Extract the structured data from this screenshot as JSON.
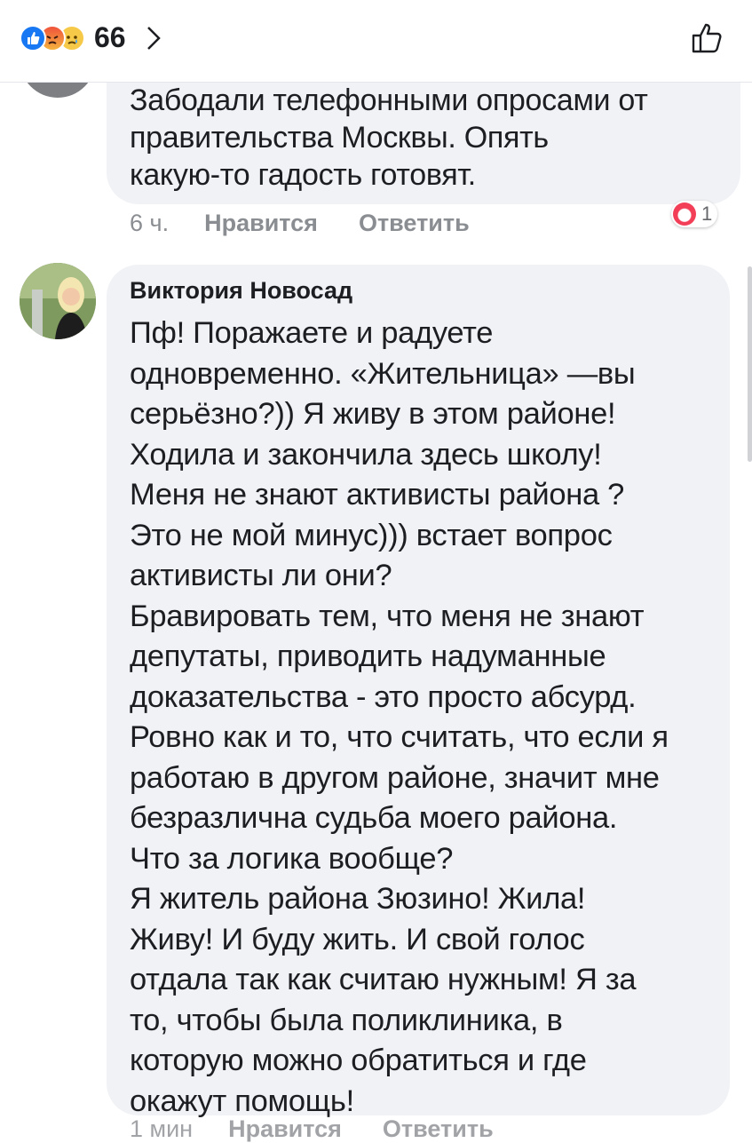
{
  "header": {
    "reaction_count": "66",
    "reaction_icons": [
      "like-icon",
      "angry-icon",
      "sad-icon"
    ],
    "like_icon": "thumbs-up-outline-icon"
  },
  "previous_comment": {
    "text": "Забодали телефонными опросами от\nправительства Москвы. Опять\nкакую-то гадость готовят.",
    "time": "6 ч.",
    "like_label": "Нравится",
    "reply_label": "Ответить",
    "reaction_count": "1"
  },
  "comment": {
    "author": "Виктория Новосад",
    "text": "Пф! Поражаете и радуете\nодновременно. «Жительница» —вы\nсерьёзно?)) Я живу в этом районе!\nХодила и закончила здесь школу!\nМеня не знают активисты района ?\nЭто не мой минус))) встает вопрос\nактивисты ли они?\nБравировать тем, что меня не знают\nдепутаты, приводить надуманные\nдоказательства - это просто абсурд.\nРовно как и то, что считать, что если я\nработаю в другом районе, значит мне\nбезразлична судьба моего района.\nЧто за логика вообще?\nЯ житель района Зюзино! Жила!\nЖиву! И буду жить. И свой голос\nотдала так как считаю нужным! Я за\nто, чтобы была поликлиника, в\nкоторую можно обратиться и где\nокажут помощь!",
    "time": "1 мин",
    "like_label": "Нравится",
    "reply_label": "Ответить"
  },
  "colors": {
    "bubble": "#f0f2f5",
    "meta": "#8a8d91",
    "like_blue": "#1877f2",
    "heart_red": "#f33e58"
  }
}
